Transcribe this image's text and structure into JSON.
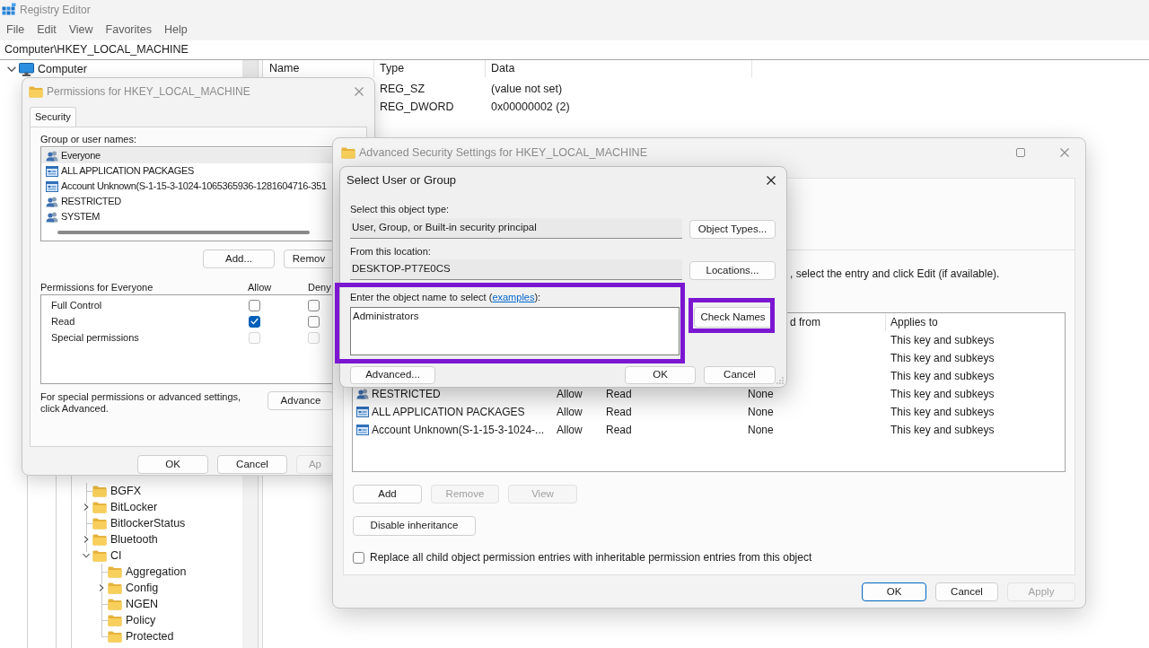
{
  "registry_editor": {
    "title": "Registry Editor",
    "menu": [
      "File",
      "Edit",
      "View",
      "Favorites",
      "Help"
    ],
    "address": "Computer\\HKEY_LOCAL_MACHINE",
    "tree": {
      "root": {
        "label": "Computer",
        "expanded": true
      },
      "items": [
        {
          "label": "BGFX"
        },
        {
          "label": "BitLocker",
          "expanded": false
        },
        {
          "label": "BitlockerStatus"
        },
        {
          "label": "Bluetooth",
          "expanded": false
        },
        {
          "label": "CI",
          "expanded": true,
          "children": [
            {
              "label": "Aggregation"
            },
            {
              "label": "Config",
              "expanded": false
            },
            {
              "label": "NGEN"
            },
            {
              "label": "Policy"
            },
            {
              "label": "Protected"
            }
          ]
        }
      ]
    },
    "values": {
      "columns": [
        "Name",
        "Type",
        "Data"
      ],
      "rows": [
        {
          "type": "REG_SZ",
          "data": "(value not set)"
        },
        {
          "type": "REG_DWORD",
          "data": "0x00000002 (2)"
        }
      ]
    }
  },
  "permissions_dialog": {
    "title": "Permissions for HKEY_LOCAL_MACHINE",
    "tabs": [
      {
        "label": "Security",
        "selected": true
      }
    ],
    "group_label": "Group or user names:",
    "principals": [
      {
        "name": "Everyone",
        "kind": "group",
        "selected": true
      },
      {
        "name": "ALL APPLICATION PACKAGES",
        "kind": "package",
        "selected": false
      },
      {
        "name": "Account Unknown(S-1-15-3-1024-1065365936-1281604716-351",
        "kind": "package",
        "selected": false
      },
      {
        "name": "RESTRICTED",
        "kind": "group",
        "selected": false
      },
      {
        "name": "SYSTEM",
        "kind": "group",
        "selected": false
      }
    ],
    "principal_buttons": [
      "Add...",
      "Remov"
    ],
    "permissions_label": "Permissions for Everyone",
    "permission_columns": [
      "Allow",
      "Deny"
    ],
    "permissions": [
      {
        "name": "Full Control",
        "allow": false,
        "deny": false,
        "disabled": false
      },
      {
        "name": "Read",
        "allow": true,
        "deny": false,
        "disabled": false
      },
      {
        "name": "Special permissions",
        "allow": false,
        "deny": false,
        "disabled": true
      }
    ],
    "advanced_note": "For special permissions or advanced settings, click Advanced.",
    "advanced_button": "Advance",
    "buttons": [
      {
        "label": "OK",
        "disabled": false
      },
      {
        "label": "Cancel",
        "disabled": false
      },
      {
        "label": "Ap",
        "disabled": true
      }
    ]
  },
  "advanced_security_window": {
    "title": "Advanced Security Settings for HKEY_LOCAL_MACHINE",
    "instructions": ", select the entry and click Edit (if available).",
    "table": {
      "headers": {
        "column_4": "d from",
        "column_5": "Applies to"
      },
      "rows": [
        {
          "column_5": "This key and subkeys"
        },
        {
          "column_5": "This key and subkeys"
        },
        {
          "column_5": "This key and subkeys"
        },
        {
          "column_1": "RESTRICTED",
          "kind": "group",
          "column_2": "Allow",
          "column_3": "Read",
          "column_4": "None",
          "column_5": "This key and subkeys"
        },
        {
          "column_1": "ALL APPLICATION PACKAGES",
          "kind": "package",
          "column_2": "Allow",
          "column_3": "Read",
          "column_4": "None",
          "column_5": "This key and subkeys"
        },
        {
          "column_1": "Account Unknown(S-1-15-3-1024-...",
          "kind": "package",
          "column_2": "Allow",
          "column_3": "Read",
          "column_4": "None",
          "column_5": "This key and subkeys"
        }
      ]
    },
    "action_buttons": [
      {
        "label": "Add",
        "disabled": false
      },
      {
        "label": "Remove",
        "disabled": true
      },
      {
        "label": "View",
        "disabled": true
      }
    ],
    "inheritance_button": "Disable inheritance",
    "replace_option": {
      "label": "Replace all child object permission entries with inheritable permission entries from this object",
      "checked": false
    },
    "footer_buttons": [
      {
        "label": "OK",
        "default": true,
        "disabled": false
      },
      {
        "label": "Cancel",
        "default": false,
        "disabled": false
      },
      {
        "label": "Apply",
        "default": false,
        "disabled": true
      }
    ]
  },
  "select_dialog": {
    "title": "Select User or Group",
    "object_type": {
      "label": "Select this object type:",
      "value": "User, Group, or Built-in security principal",
      "button": "Object Types..."
    },
    "location": {
      "label": "From this location:",
      "value": "DESKTOP-PT7E0CS",
      "button": "Locations..."
    },
    "object_name": {
      "label_start": "Enter the object name to select (",
      "link": "examples",
      "label_end": "):",
      "value": "Administrators",
      "highlighted": true
    },
    "check_names": {
      "label": "Check Names",
      "highlighted": true
    },
    "buttons": [
      {
        "label": "Advanced..."
      },
      {
        "label": "OK"
      },
      {
        "label": "Cancel"
      }
    ]
  }
}
